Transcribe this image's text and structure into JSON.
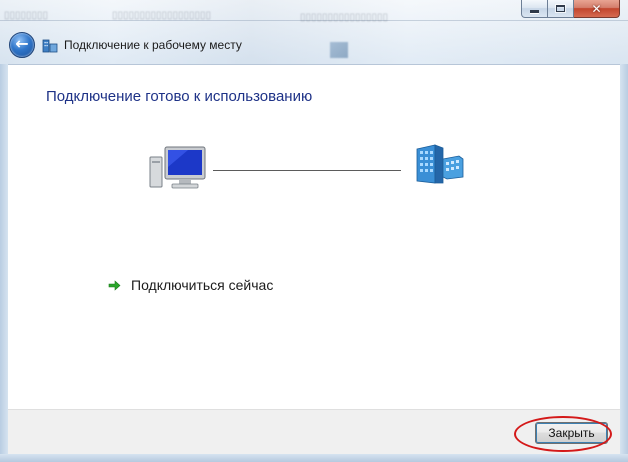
{
  "window": {
    "title": "Подключение к рабочему месту",
    "caption_buttons": {
      "minimize": "minimize-icon",
      "maximize": "maximize-icon",
      "close": "close-icon"
    },
    "close_glyph": "✕"
  },
  "nav": {
    "back_icon": "back-arrow-icon",
    "back_glyph": "←"
  },
  "content": {
    "heading": "Подключение готово к использованию",
    "connect_link": "Подключиться сейчас",
    "icons": {
      "local": "computer-icon",
      "remote": "network-building-icon",
      "link_arrow": "green-arrow-icon"
    }
  },
  "footer": {
    "close_button": "Закрыть"
  },
  "colors": {
    "heading": "#1e3287",
    "arrow": "#2aa52a",
    "annotation": "#d41919"
  }
}
